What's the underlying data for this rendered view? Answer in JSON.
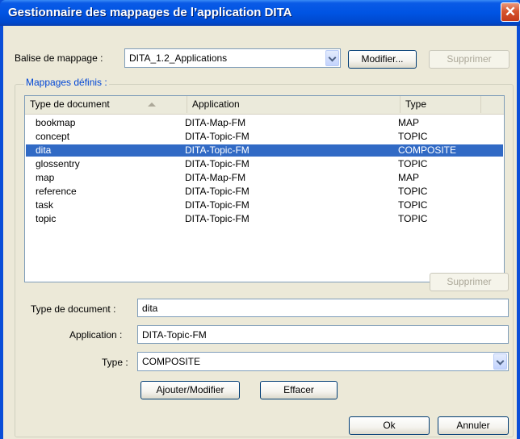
{
  "window": {
    "title": "Gestionnaire des mappages de l’application DITA",
    "close_glyph": "✕"
  },
  "mapping_tag": {
    "label": "Balise de mappage :",
    "value": "DITA_1.2_Applications",
    "modify_label": "Modifier...",
    "delete_label": "Supprimer"
  },
  "group": {
    "title": "Mappages définis :"
  },
  "list": {
    "headers": {
      "doctype": "Type de document",
      "application": "Application",
      "type": "Type"
    },
    "rows": [
      {
        "doctype": "bookmap",
        "application": "DITA-Map-FM",
        "type": "MAP"
      },
      {
        "doctype": "concept",
        "application": "DITA-Topic-FM",
        "type": "TOPIC"
      },
      {
        "doctype": "dita",
        "application": "DITA-Topic-FM",
        "type": "COMPOSITE"
      },
      {
        "doctype": "glossentry",
        "application": "DITA-Topic-FM",
        "type": "TOPIC"
      },
      {
        "doctype": "map",
        "application": "DITA-Map-FM",
        "type": "MAP"
      },
      {
        "doctype": "reference",
        "application": "DITA-Topic-FM",
        "type": "TOPIC"
      },
      {
        "doctype": "task",
        "application": "DITA-Topic-FM",
        "type": "TOPIC"
      },
      {
        "doctype": "topic",
        "application": "DITA-Topic-FM",
        "type": "TOPIC"
      }
    ],
    "selected_row": 2,
    "delete_label": "Supprimer"
  },
  "form": {
    "doctype_label": "Type de document :",
    "doctype_value": "dita",
    "application_label": "Application :",
    "application_value": "DITA-Topic-FM",
    "type_label": "Type :",
    "type_value": "COMPOSITE",
    "add_modify_label": "Ajouter/Modifier",
    "clear_label": "Effacer"
  },
  "footer": {
    "ok_label": "Ok",
    "cancel_label": "Annuler"
  },
  "colors": {
    "titlebar": "#0054e3",
    "selection": "#316ac5",
    "dialog_bg": "#ece9d8",
    "group_title": "#0046d5"
  }
}
